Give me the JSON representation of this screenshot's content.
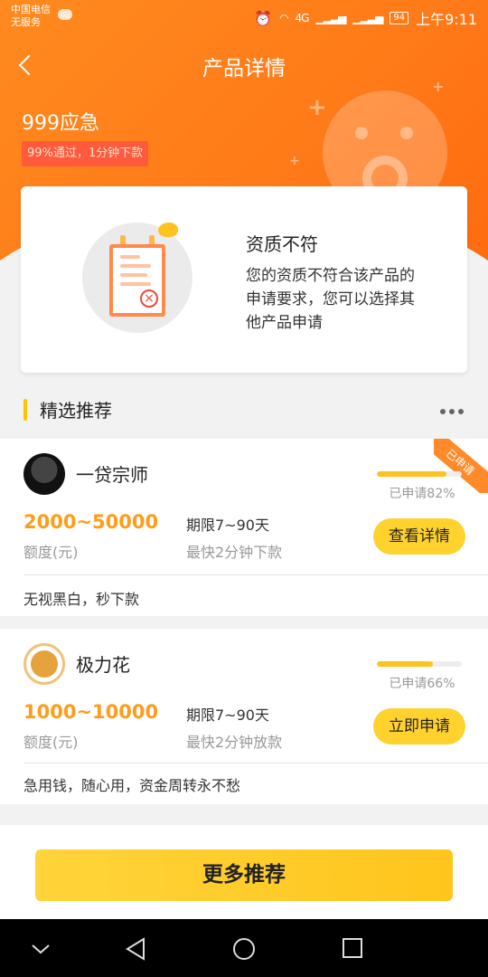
{
  "status_bar": {
    "carrier_line1": "中国电信",
    "carrier_line2": "无服务",
    "network": "4G",
    "battery": "94",
    "time": "上午9:11"
  },
  "nav": {
    "title": "产品详情"
  },
  "product": {
    "name": "999应急",
    "tag": "99%通过，1分钟下款"
  },
  "result": {
    "title": "资质不符",
    "description": "您的资质不符合该产品的申请要求，您可以选择其他产品申请"
  },
  "section": {
    "title": "精选推荐"
  },
  "recommendations": [
    {
      "name": "一贷宗师",
      "ribbon": "已申请",
      "applied_text": "已申请82%",
      "applied_fraction": 0.82,
      "amount": "2000~50000",
      "amount_label": "额度(元)",
      "term": "期限7~90天",
      "speed": "最快2分钟下款",
      "button": "查看详情",
      "slogan": "无视黑白，秒下款"
    },
    {
      "name": "极力花",
      "applied_text": "已申请66%",
      "applied_fraction": 0.66,
      "amount": "1000~10000",
      "amount_label": "额度(元)",
      "term": "期限7~90天",
      "speed": "最快2分钟放款",
      "button": "立即申请",
      "slogan": "急用钱，随心用，资金周转永不愁"
    }
  ],
  "more_button": "更多推荐",
  "icons": [
    "chat-icon",
    "alarm-icon",
    "wifi-icon",
    "signal-icon",
    "battery-icon",
    "back-icon",
    "sad-face-icon",
    "clipboard-reject-icon",
    "more-dots-icon",
    "nav-down-icon",
    "nav-back-icon",
    "nav-home-icon",
    "nav-recent-icon"
  ],
  "colors": {
    "header": "#ff7a18",
    "accent": "#ffc300",
    "amount": "#ff9c1a",
    "button": "#ffd22e",
    "tag": "#ff5a3c"
  }
}
